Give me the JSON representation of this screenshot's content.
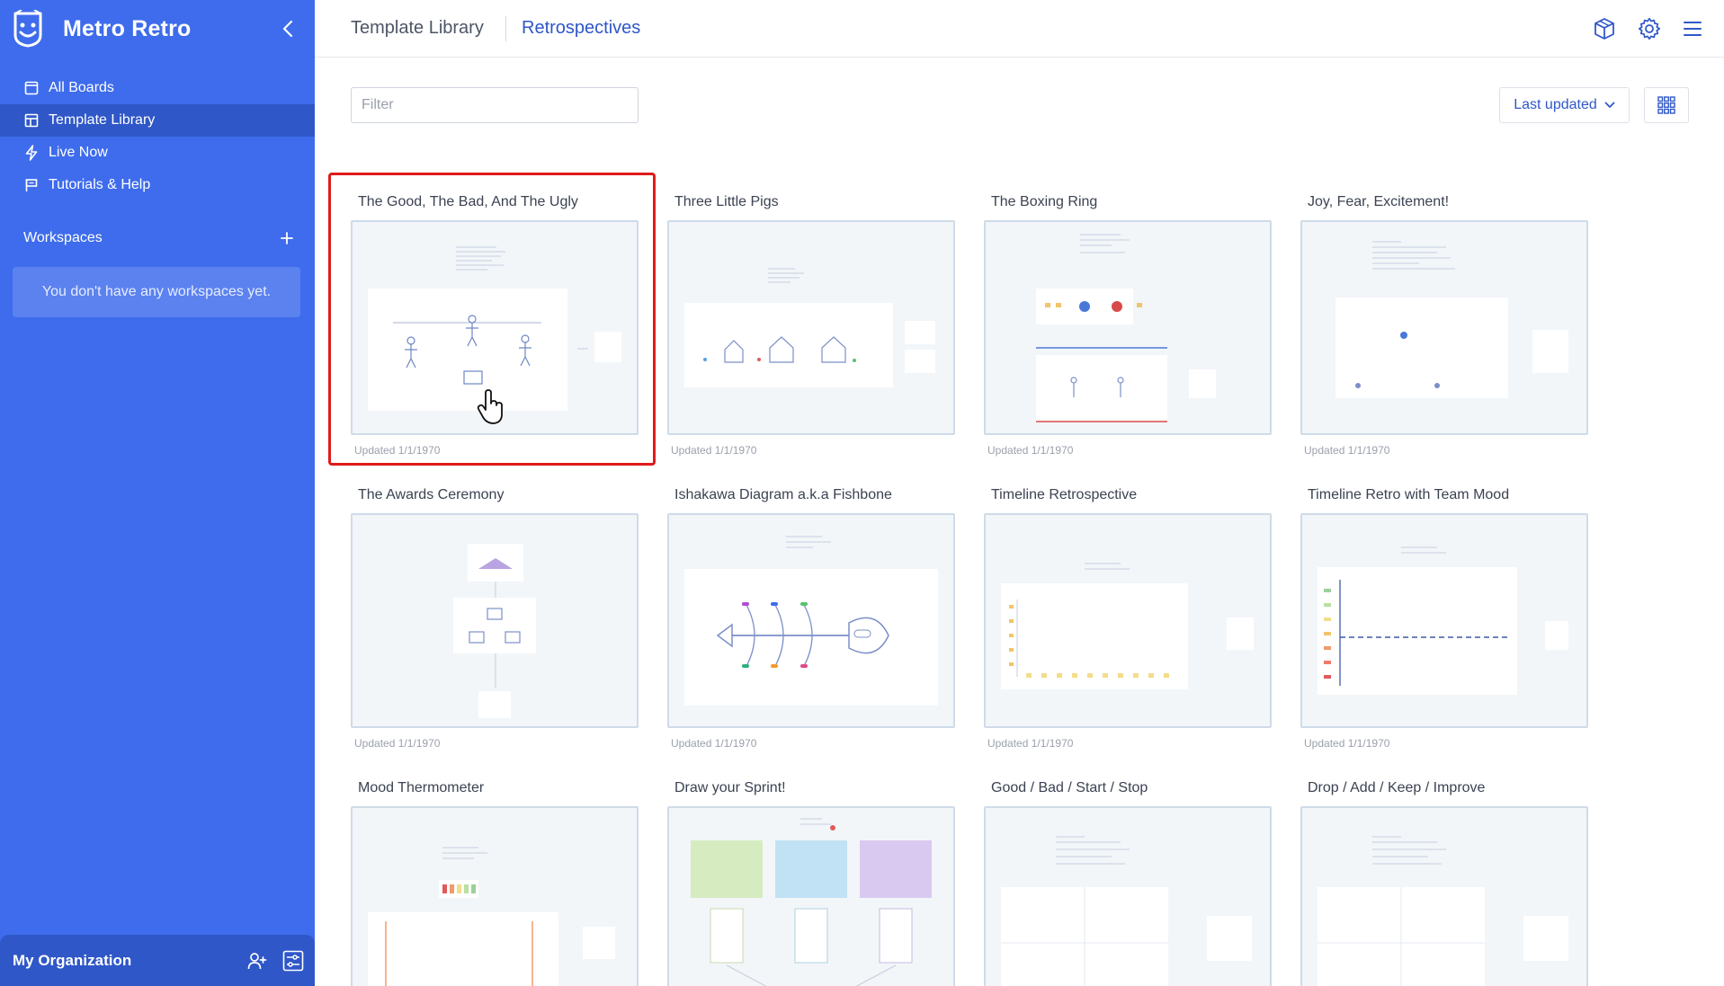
{
  "sidebar": {
    "brand": "Metro Retro",
    "nav": [
      {
        "label": "All Boards",
        "icon": "board-icon",
        "active": false
      },
      {
        "label": "Template Library",
        "icon": "template-icon",
        "active": true
      },
      {
        "label": "Live Now",
        "icon": "lightning-icon",
        "active": false
      },
      {
        "label": "Tutorials & Help",
        "icon": "flag-icon",
        "active": false
      }
    ],
    "workspaces_label": "Workspaces",
    "workspaces_empty": "You don't have any workspaces yet.",
    "org_name": "My Organization"
  },
  "header": {
    "breadcrumb_root": "Template Library",
    "breadcrumb_current": "Retrospectives",
    "icons": [
      "box-icon",
      "gear-icon",
      "hamburger-icon"
    ]
  },
  "toolbar": {
    "filter_placeholder": "Filter",
    "sort_label": "Last updated"
  },
  "templates": [
    {
      "title": "The Good, The Bad, And The Ugly",
      "updated": "Updated 1/1/1970",
      "selected": true
    },
    {
      "title": "Three Little Pigs",
      "updated": "Updated 1/1/1970"
    },
    {
      "title": "The Boxing Ring",
      "updated": "Updated 1/1/1970"
    },
    {
      "title": "Joy, Fear, Excitement!",
      "updated": "Updated 1/1/1970"
    },
    {
      "title": "The Awards Ceremony",
      "updated": "Updated 1/1/1970"
    },
    {
      "title": "Ishakawa Diagram a.k.a Fishbone",
      "updated": "Updated 1/1/1970"
    },
    {
      "title": "Timeline Retrospective",
      "updated": "Updated 1/1/1970"
    },
    {
      "title": "Timeline Retro with Team Mood",
      "updated": "Updated 1/1/1970"
    },
    {
      "title": "Mood Thermometer",
      "updated": ""
    },
    {
      "title": "Draw your Sprint!",
      "updated": ""
    },
    {
      "title": "Good / Bad / Start / Stop",
      "updated": ""
    },
    {
      "title": "Drop / Add / Keep / Improve",
      "updated": ""
    }
  ],
  "colors": {
    "sidebar": "#3e6cec",
    "sidebar_active": "#2f57c8",
    "accent": "#2f57c8",
    "selection": "#e01b1b"
  }
}
